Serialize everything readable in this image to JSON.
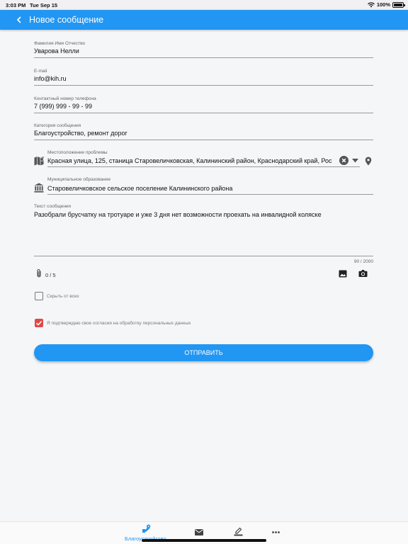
{
  "status_bar": {
    "time": "3:03 PM",
    "date": "Tue Sep 15",
    "battery": "100%"
  },
  "app_bar": {
    "title": "Новое сообщение"
  },
  "form": {
    "full_name": {
      "label": "Фамилия Имя Отчество",
      "value": "Уварова Нелли"
    },
    "email": {
      "label": "E-mail",
      "value": "info@kih.ru"
    },
    "phone": {
      "label": "Контактный номер телефона",
      "value": "7 (999) 999 - 99 - 99"
    },
    "category": {
      "label": "Категория сообщения",
      "value": "Благоустройство, ремонт дорог"
    },
    "location": {
      "label": "Местоположение проблемы",
      "value": "Красная улица, 125, станица Старовеличковская, Калининский район, Краснодарский край, Рос"
    },
    "municipality": {
      "label": "Муниципальное образование",
      "value": "Старовеличковское сельское поселение Калининского района"
    },
    "message": {
      "label": "Текст сообщения",
      "value": "Разобрали брусчатку на тротуаре и уже 3 дня нет возможности проехать на инвалидной коляске",
      "counter": "90 / 2000"
    },
    "attachments": {
      "count": "0 / 5"
    },
    "hide_from_all": {
      "label": "Скрыть от всех",
      "checked": false
    },
    "consent": {
      "label": "Я подтверждаю свое согласия на обработку персональных данных",
      "checked": true
    },
    "submit_label": "ОТПРАВИТЬ"
  },
  "bottom_nav": {
    "items": [
      {
        "label": "Благоустройство",
        "icon": "location-edit-icon",
        "active": true
      },
      {
        "label": "",
        "icon": "mail-icon",
        "active": false
      },
      {
        "label": "",
        "icon": "edit-icon",
        "active": false
      },
      {
        "label": "",
        "icon": "more-icon",
        "active": false
      }
    ]
  },
  "colors": {
    "primary": "#2196f3",
    "checkbox_checked": "#e04848",
    "background": "#f5f6f8"
  }
}
